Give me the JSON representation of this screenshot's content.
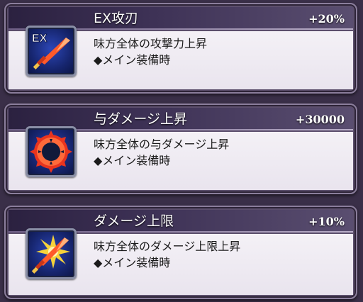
{
  "skills": [
    {
      "title": "EX攻刃",
      "value": "+20%",
      "description": "味方全体の攻撃力上昇",
      "condition": "◆メイン装備時",
      "icon": "ex-attack-sword-icon",
      "icon_badge": "EX"
    },
    {
      "title": "与ダメージ上昇",
      "value": "+30000",
      "description": "味方全体の与ダメージ上昇",
      "condition": "◆メイン装備時",
      "icon": "damage-burst-icon"
    },
    {
      "title": "ダメージ上限",
      "value": "+10%",
      "description": "味方全体のダメージ上限上昇",
      "condition": "◆メイン装備時",
      "icon": "damage-cap-icon"
    }
  ],
  "colors": {
    "frame": "#5c4f6c",
    "header_dark": "#2b2140",
    "panel_light": "#f4f1f6",
    "icon_blue": "#2c46b6"
  }
}
